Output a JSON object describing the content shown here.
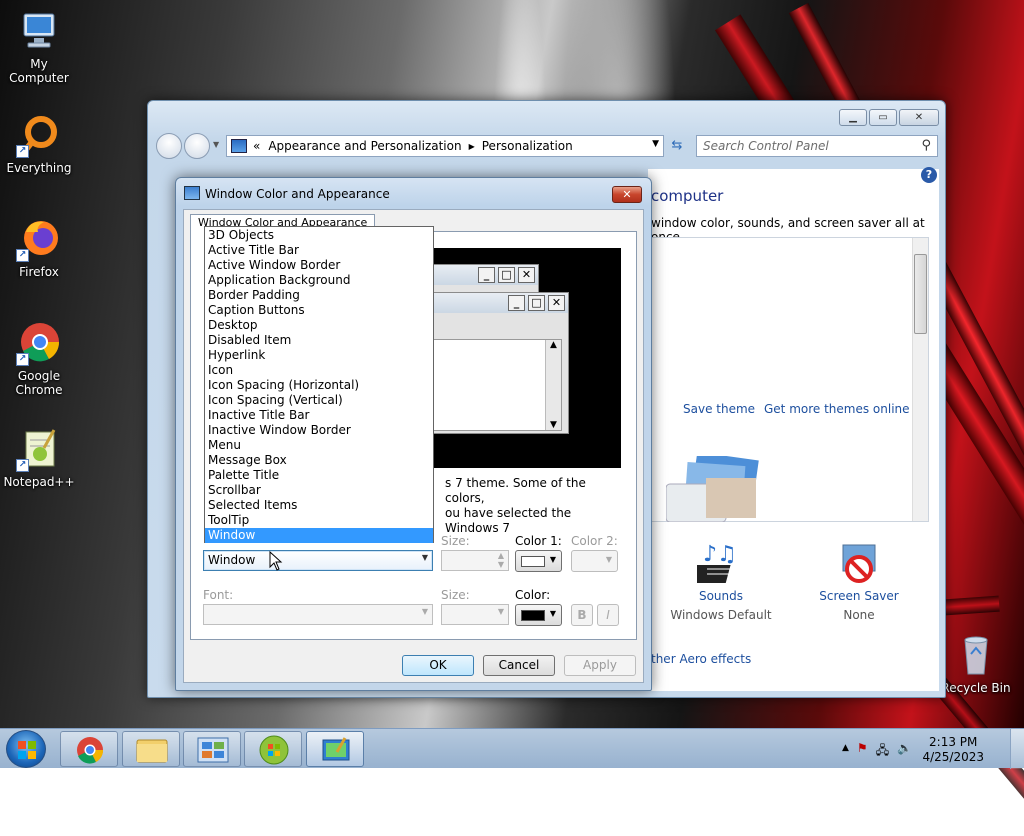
{
  "desktop": {
    "icons": [
      {
        "label": "My Computer"
      },
      {
        "label": "Everything"
      },
      {
        "label": "Firefox"
      },
      {
        "label": "Google Chrome"
      },
      {
        "label": "Notepad++"
      },
      {
        "label": "Recycle Bin"
      }
    ]
  },
  "control_panel": {
    "breadcrumb": {
      "root": "«",
      "item1": "Appearance and Personalization",
      "item2": "Personalization"
    },
    "search_placeholder": "Search Control Panel",
    "heading": "computer",
    "subheading": "window color, sounds, and screen saver all at once.",
    "save_theme": "Save theme",
    "more_themes": "Get more themes online",
    "sounds": {
      "label": "Sounds",
      "value": "Windows Default"
    },
    "screen_saver": {
      "label": "Screen Saver",
      "value": "None"
    },
    "aero_link": "ther Aero effects",
    "help": "?"
  },
  "dialog": {
    "title": "Window Color and Appearance",
    "tab": "Window Color and Appearance",
    "description_line1": "s 7 theme.  Some of the colors,",
    "description_line2": "ou have selected the Windows 7",
    "size_label": "Size:",
    "color1_label": "Color 1:",
    "color2_label": "Color 2:",
    "font_label": "Font:",
    "font_size_label": "Size:",
    "font_color_label": "Color:",
    "item_value": "Window",
    "bold_label": "B",
    "italic_label": "I",
    "ok": "OK",
    "cancel": "Cancel",
    "apply": "Apply",
    "close_glyph": "✕",
    "colors": {
      "color1": "#ffffff",
      "font_color": "#000000"
    },
    "item_options": [
      "3D Objects",
      "Active Title Bar",
      "Active Window Border",
      "Application Background",
      "Border Padding",
      "Caption Buttons",
      "Desktop",
      "Disabled Item",
      "Hyperlink",
      "Icon",
      "Icon Spacing (Horizontal)",
      "Icon Spacing (Vertical)",
      "Inactive Title Bar",
      "Inactive Window Border",
      "Menu",
      "Message Box",
      "Palette Title",
      "Scrollbar",
      "Selected Items",
      "ToolTip",
      "Window"
    ],
    "selected_option": "Window"
  },
  "taskbar": {
    "time": "2:13 PM",
    "date": "4/25/2023"
  }
}
